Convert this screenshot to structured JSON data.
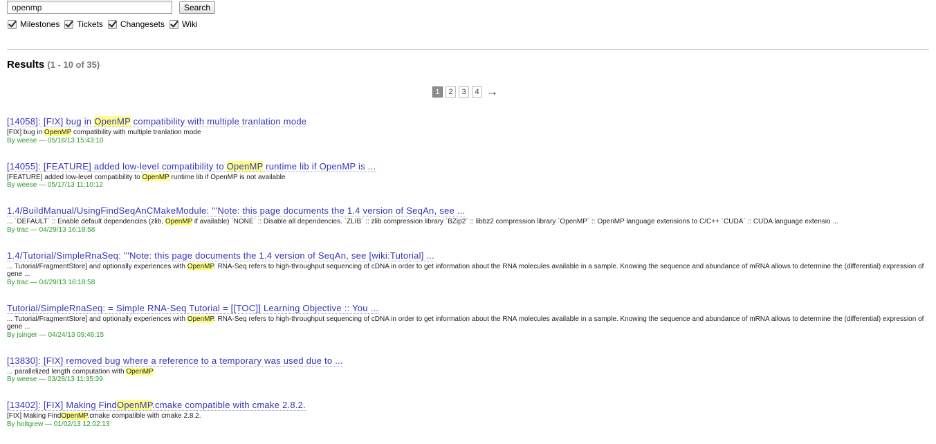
{
  "search": {
    "query": "openmp",
    "button_label": "Search"
  },
  "filters": [
    {
      "label": "Milestones",
      "checked": true
    },
    {
      "label": "Tickets",
      "checked": true
    },
    {
      "label": "Changesets",
      "checked": true
    },
    {
      "label": "Wiki",
      "checked": true
    }
  ],
  "results_heading": {
    "title": "Results",
    "range": "(1 - 10 of 35)"
  },
  "paging": {
    "pages": [
      "1",
      "2",
      "3",
      "4"
    ],
    "current": "1",
    "next_symbol": "→"
  },
  "colors": {
    "link": "#3333bb",
    "meta": "#2a9a2a",
    "highlight": "#ffff88"
  },
  "results": [
    {
      "title": [
        "[14058]: [FIX] bug in ",
        "OpenMP",
        " compatibility with multiple tranlation mode"
      ],
      "excerpt": [
        "[FIX] bug in ",
        "OpenMP",
        " compatibility with multiple tranlation mode"
      ],
      "meta": "By weese — 05/18/13 15:43:10"
    },
    {
      "title": [
        "[14055]: [FEATURE] added low-level compatibility to ",
        "OpenMP",
        " runtime lib if OpenMP is ..."
      ],
      "excerpt": [
        "[FEATURE] added low-level compatibility to ",
        "OpenMP",
        " runtime lib if OpenMP is not available"
      ],
      "meta": "By weese — 05/17/13 11:10:12"
    },
    {
      "title": [
        "1.4/BuildManual/UsingFindSeqAnCMakeModule: '''Note: this page documents the 1.4 version of SeqAn, see ..."
      ],
      "excerpt": [
        "... `DEFAULT` :: Enable default dependencies (zlib, ",
        "OpenMP",
        " if available) `NONE` :: Disable all dependencies. `ZLIB` :: zlib compression library `BZip2` :: libbz2 compression library `OpenMP` :: OpenMP language extensions to C/C++ `CUDA` :: CUDA language extensio ..."
      ],
      "meta": "By trac — 04/29/13 16:18:58"
    },
    {
      "title": [
        "1.4/Tutorial/SimpleRnaSeq: '''Note: this page documents the 1.4 version of SeqAn, see [wiki:Tutorial] ..."
      ],
      "excerpt": [
        "... Tutorial/FragmentStore] and optionally experiences with ",
        "OpenMP",
        ". RNA-Seq refers to high-throughput sequencing of cDNA in order to get information about the RNA molecules available in a sample. Knowing the sequence and abundance of mRNA allows to determine the (differential) expression of gene ..."
      ],
      "meta": "By trac — 04/29/13 16:18:58"
    },
    {
      "title": [
        "Tutorial/SimpleRnaSeq: = Simple RNA-Seq Tutorial = [[TOC]] Learning Objective :: You ..."
      ],
      "excerpt": [
        "... Tutorial/FragmentStore] and optionally experiences with ",
        "OpenMP",
        ". RNA-Seq refers to high-throughput sequencing of cDNA in order to get information about the RNA molecules available in a sample. Knowing the sequence and abundance of mRNA allows to determine the (differential) expression of gene ..."
      ],
      "meta": "By jsinger — 04/24/13 09:46:15"
    },
    {
      "title": [
        "[13830]: [FIX] removed bug where a reference to a temporary was used due to ..."
      ],
      "excerpt": [
        "... parallelized length computation with ",
        "OpenMP",
        ""
      ],
      "meta": "By weese — 03/28/13 11:35:39"
    },
    {
      "title": [
        "[13402]: [FIX] Making Find",
        "OpenMP",
        ".cmake compatible with cmake 2.8.2."
      ],
      "excerpt": [
        "[FIX] Making Find",
        "OpenMP",
        ".cmake compatible with cmake 2.8.2."
      ],
      "meta": "By holtgrew — 01/02/13 12:02:13"
    }
  ]
}
